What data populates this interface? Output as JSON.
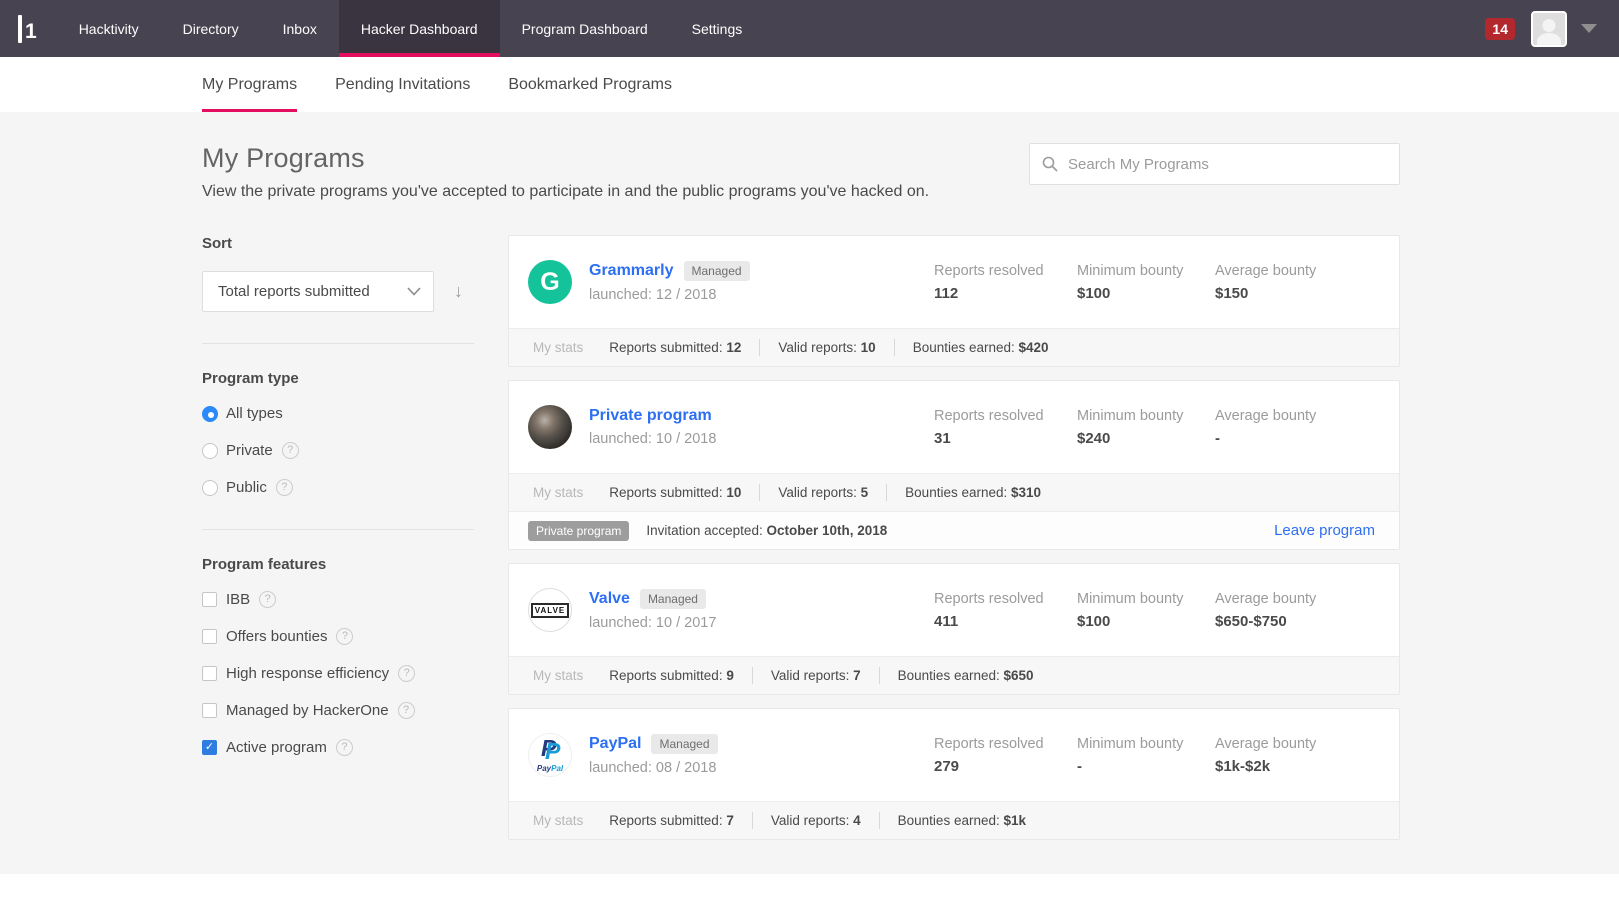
{
  "colors": {
    "nav_bg": "#484350",
    "nav_active_bg": "#393440",
    "accent_pink": "#e50e5e",
    "link_blue": "#2d6ff2",
    "notification_red": "#b3282d",
    "grammarly_green": "#15c39a",
    "paypal_dark_blue": "#253b80",
    "paypal_light_blue": "#179bd7",
    "selected_blue": "#2b8af9"
  },
  "nav": {
    "items": [
      {
        "label": "Hacktivity",
        "active": false
      },
      {
        "label": "Directory",
        "active": false
      },
      {
        "label": "Inbox",
        "active": false
      },
      {
        "label": "Hacker Dashboard",
        "active": true
      },
      {
        "label": "Program Dashboard",
        "active": false
      },
      {
        "label": "Settings",
        "active": false
      }
    ],
    "notification_count": "14"
  },
  "tabs": [
    {
      "label": "My Programs",
      "active": true
    },
    {
      "label": "Pending Invitations",
      "active": false
    },
    {
      "label": "Bookmarked Programs",
      "active": false
    }
  ],
  "page": {
    "title": "My Programs",
    "description": "View the private programs you've accepted to participate in and the public programs you've hacked on.",
    "search_placeholder": "Search My Programs"
  },
  "sidebar": {
    "sort": {
      "heading": "Sort",
      "selected": "Total reports submitted",
      "direction_arrow": "↓"
    },
    "program_type": {
      "heading": "Program type",
      "options": [
        {
          "label": "All types",
          "selected": true,
          "help": false
        },
        {
          "label": "Private",
          "selected": false,
          "help": true
        },
        {
          "label": "Public",
          "selected": false,
          "help": true
        }
      ]
    },
    "program_features": {
      "heading": "Program features",
      "options": [
        {
          "label": "IBB",
          "checked": false
        },
        {
          "label": "Offers bounties",
          "checked": false
        },
        {
          "label": "High response efficiency",
          "checked": false
        },
        {
          "label": "Managed by HackerOne",
          "checked": false
        },
        {
          "label": "Active program",
          "checked": true
        }
      ]
    }
  },
  "my_stats_label": "My stats",
  "programs": [
    {
      "name": "Grammarly",
      "managed": "Managed",
      "launched": "launched: 12 / 2018",
      "logo": {
        "kind": "grammarly",
        "text": "G"
      },
      "stats": [
        {
          "label": "Reports resolved",
          "value": "112"
        },
        {
          "label": "Minimum bounty",
          "value": "$100"
        },
        {
          "label": "Average bounty",
          "value": "$150"
        }
      ],
      "my_stats": [
        {
          "label": "Reports submitted:",
          "value": "12"
        },
        {
          "label": "Valid reports:",
          "value": "10"
        },
        {
          "label": "Bounties earned:",
          "value": "$420"
        }
      ]
    },
    {
      "name": "Private program",
      "managed": "",
      "launched": "launched: 10 / 2018",
      "logo": {
        "kind": "bird"
      },
      "stats": [
        {
          "label": "Reports resolved",
          "value": "31"
        },
        {
          "label": "Minimum bounty",
          "value": "$240"
        },
        {
          "label": "Average bounty",
          "value": "-"
        }
      ],
      "my_stats": [
        {
          "label": "Reports submitted:",
          "value": "10"
        },
        {
          "label": "Valid reports:",
          "value": "5"
        },
        {
          "label": "Bounties earned:",
          "value": "$310"
        }
      ],
      "private_row": {
        "badge": "Private program",
        "label": "Invitation accepted:",
        "value": "October 10th, 2018",
        "action": "Leave program"
      }
    },
    {
      "name": "Valve",
      "managed": "Managed",
      "launched": "launched: 10 / 2017",
      "logo": {
        "kind": "valve",
        "text": "VALVE"
      },
      "stats": [
        {
          "label": "Reports resolved",
          "value": "411"
        },
        {
          "label": "Minimum bounty",
          "value": "$100"
        },
        {
          "label": "Average bounty",
          "value": "$650-$750"
        }
      ],
      "my_stats": [
        {
          "label": "Reports submitted:",
          "value": "9"
        },
        {
          "label": "Valid reports:",
          "value": "7"
        },
        {
          "label": "Bounties earned:",
          "value": "$650"
        }
      ]
    },
    {
      "name": "PayPal",
      "managed": "Managed",
      "launched": "launched: 08 / 2018",
      "logo": {
        "kind": "paypal",
        "text": "PayPal"
      },
      "stats": [
        {
          "label": "Reports resolved",
          "value": "279"
        },
        {
          "label": "Minimum bounty",
          "value": "-"
        },
        {
          "label": "Average bounty",
          "value": "$1k-$2k"
        }
      ],
      "my_stats": [
        {
          "label": "Reports submitted:",
          "value": "7"
        },
        {
          "label": "Valid reports:",
          "value": "4"
        },
        {
          "label": "Bounties earned:",
          "value": "$1k"
        }
      ]
    }
  ]
}
